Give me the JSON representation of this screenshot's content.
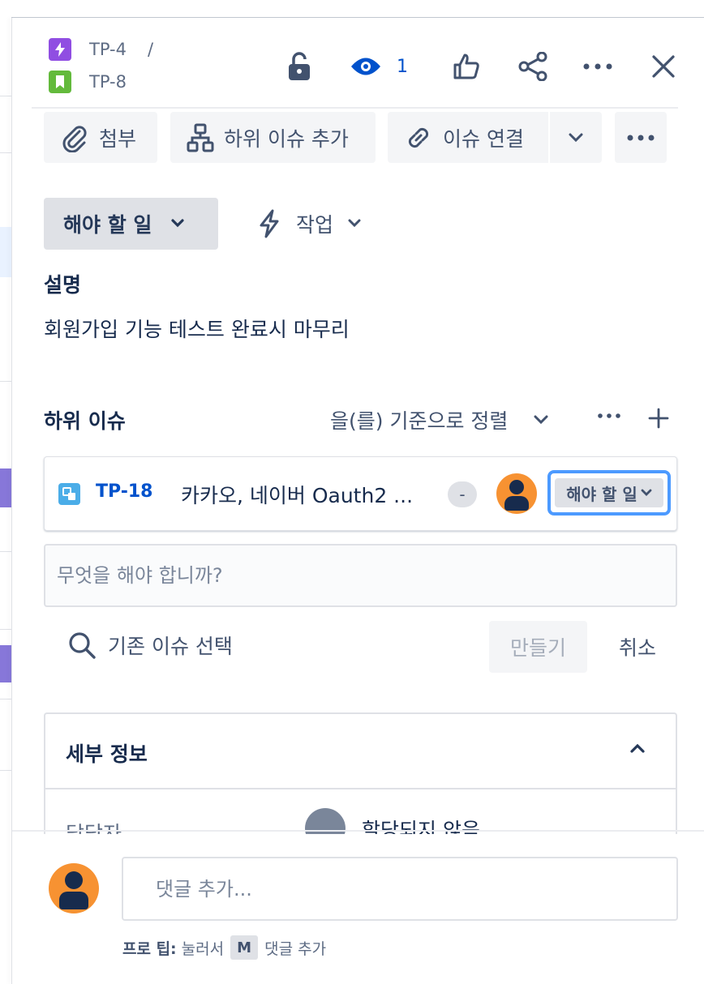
{
  "breadcrumb": {
    "parent_key": "TP-4",
    "separator": "/",
    "issue_key": "TP-8",
    "parent_icon": "epic-lightning-icon",
    "issue_icon": "story-bookmark-icon"
  },
  "header": {
    "watch_count": "1",
    "icons": [
      "unlock-icon",
      "eye-icon",
      "thumbs-up-icon",
      "share-icon",
      "more-icon",
      "close-icon"
    ]
  },
  "toolbar": {
    "attach_label": "첨부",
    "add_child_label": "하위 이슈 추가",
    "link_issue_label": "이슈 연결"
  },
  "status": {
    "current": "해야 할 일",
    "action_label": "작업"
  },
  "description": {
    "title": "설명",
    "text": "회원가입 기능 테스트 완료시 마무리"
  },
  "child_issues": {
    "title": "하위 이슈",
    "sort_label": "을(를) 기준으로 정렬",
    "items": [
      {
        "key": "TP-18",
        "summary": "카카오, 네이버 Oauth2 ...",
        "priority": "-",
        "status": "해야 할 일"
      }
    ],
    "new_placeholder": "무엇을 해야 합니까?",
    "choose_existing_label": "기존 이슈 선택",
    "create_label": "만들기",
    "cancel_label": "취소"
  },
  "details": {
    "title": "세부 정보",
    "assignee_label": "담당자",
    "assignee_value": "할당되지 않음"
  },
  "comment": {
    "placeholder": "댓글 추가...",
    "tip_prefix": "프로 팁:",
    "tip_press": "눌러서",
    "tip_key": "M",
    "tip_suffix": "댓글 추가"
  },
  "colors": {
    "accent": "#0052cc",
    "avatar": "#f79232",
    "epic": "#904ee2",
    "story": "#63ba3c",
    "subtask": "#4bade8",
    "focus": "#4c9aff"
  }
}
